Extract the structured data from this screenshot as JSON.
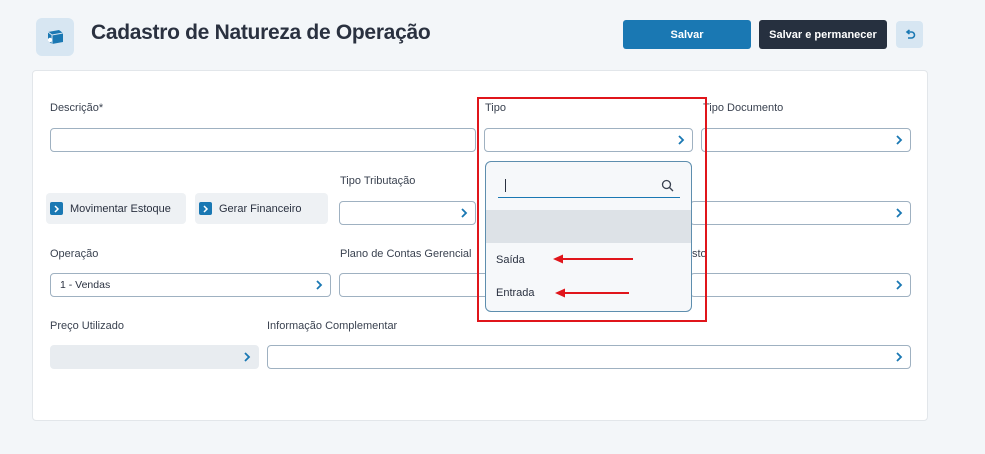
{
  "header": {
    "title": "Cadastro de Natureza de Operação",
    "save_label": "Salvar",
    "save_stay_label": "Salvar e permanecer"
  },
  "form": {
    "descricao_label": "Descrição*",
    "descricao_value": "",
    "tipo_label": "Tipo",
    "tipo_value": "",
    "tipo_documento_label": "Tipo Documento",
    "tipo_documento_value": "",
    "movimentar_estoque_label": "Movimentar Estoque",
    "gerar_financeiro_label": "Gerar Financeiro",
    "tipo_tributacao_label": "Tipo Tributação",
    "tipo_tributacao_value": "",
    "operacao_label": "Operação",
    "operacao_value": "1 - Vendas",
    "plano_contas_label": "Plano de Contas Gerencial",
    "plano_contas_value": "",
    "partial_label": "sto",
    "preco_label": "Preço Utilizado",
    "preco_value": "",
    "info_label": "Informação Complementar",
    "info_value": ""
  },
  "dropdown": {
    "search_value": "",
    "options": [
      "Saída",
      "Entrada"
    ]
  },
  "colors": {
    "primary": "#1a78b3",
    "dark": "#26303f",
    "annotation_red": "#e0151b"
  },
  "icons": {
    "header": "box-icon",
    "back": "undo-icon",
    "field_chevron": "chevron-right-icon",
    "search": "search-icon"
  }
}
